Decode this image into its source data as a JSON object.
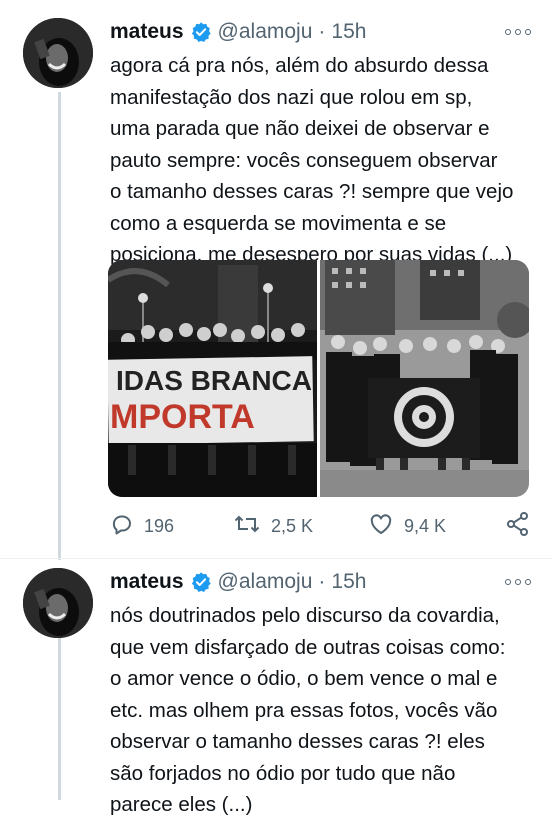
{
  "tweets": [
    {
      "name": "mateus",
      "handle": "@alamoju",
      "separator": "·",
      "time": "15h",
      "text_lines": [
        "agora cá pra nós, além do absurdo dessa",
        "manifestação dos nazi que rolou em sp,",
        "uma parada que não deixei de observar e",
        "pauto sempre: vocês conseguem observar",
        "o tamanho desses caras ?! sempre que vejo",
        "como a esquerda se movimenta e se",
        "posiciona, me desespero por suas vidas (...)"
      ],
      "banner_text_top": "IDAS BRANCA",
      "banner_text_bottom": "MPORTA",
      "actions": {
        "replies": "196",
        "retweets": "2,5 K",
        "likes": "9,4 K"
      }
    },
    {
      "name": "mateus",
      "handle": "@alamoju",
      "separator": "·",
      "time": "15h",
      "text_lines": [
        "nós doutrinados pelo discurso da covardia,",
        "que vem disfarçado de outras coisas como:",
        "o amor vence o ódio, o bem vence o mal e",
        "etc. mas olhem pra essas fotos, vocês vão",
        "observar o tamanho desses caras ?! eles",
        "são forjados no ódio por tudo que não",
        "parece eles (...)"
      ]
    }
  ],
  "colors": {
    "verified": "#1d9bf0",
    "secondary": "#536471",
    "thread_line": "#cfd9de",
    "banner_red": "#c0392b"
  },
  "icons": [
    "more-icon",
    "verified-badge-icon",
    "reply-icon",
    "retweet-icon",
    "like-icon",
    "share-icon"
  ]
}
